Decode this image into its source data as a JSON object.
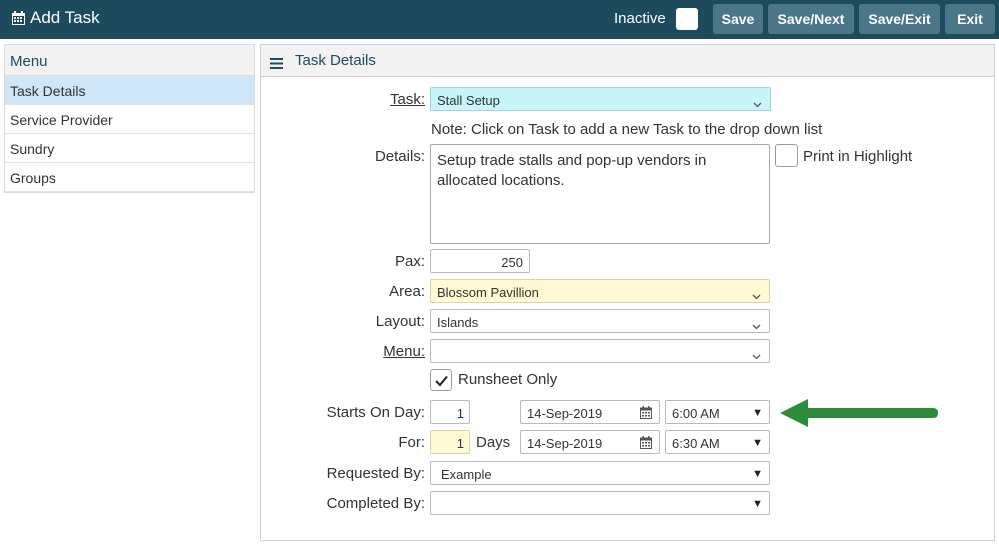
{
  "header": {
    "title": "Add Task",
    "inactive_label": "Inactive",
    "buttons": {
      "save": "Save",
      "save_next": "Save/Next",
      "save_exit": "Save/Exit",
      "exit": "Exit"
    }
  },
  "sidebar": {
    "heading": "Menu",
    "items": [
      {
        "label": "Task Details"
      },
      {
        "label": "Service Provider"
      },
      {
        "label": "Sundry"
      },
      {
        "label": "Groups"
      }
    ]
  },
  "panel": {
    "title": "Task Details"
  },
  "form": {
    "task": {
      "label": "Task:",
      "value": "Stall Setup",
      "bg": "#c8f6f8"
    },
    "note": "Note: Click on Task to add a new Task to the drop down list",
    "details": {
      "label": "Details:",
      "value": "Setup trade stalls and pop-up vendors in allocated locations."
    },
    "print_highlight": {
      "label": "Print in Highlight",
      "checked": false
    },
    "pax": {
      "label": "Pax:",
      "value": "250"
    },
    "area": {
      "label": "Area:",
      "value": "Blossom Pavillion",
      "bg": "#fff9d4"
    },
    "layout": {
      "label": "Layout:",
      "value": "Islands"
    },
    "menu": {
      "label": "Menu:",
      "value": ""
    },
    "runsheet": {
      "label": "Runsheet Only",
      "checked": true
    },
    "starts_on_day": {
      "label": "Starts On Day:",
      "day": "1",
      "date": "14-Sep-2019",
      "time": "6:00 AM"
    },
    "for": {
      "label": "For:",
      "days": "1",
      "days_label": "Days",
      "date": "14-Sep-2019",
      "time": "6:30 AM"
    },
    "requested_by": {
      "label": "Requested By:",
      "value": "Example"
    },
    "completed_by": {
      "label": "Completed By:",
      "value": ""
    }
  },
  "colors": {
    "topbar": "#1e4a5e",
    "button": "#4b7688",
    "active_item": "#cfe6f8",
    "arrow": "#2e8b3a"
  },
  "icons": [
    "calendar-icon",
    "hamburger-icon",
    "chevron-down-icon",
    "check-icon",
    "arrow-left-icon"
  ]
}
